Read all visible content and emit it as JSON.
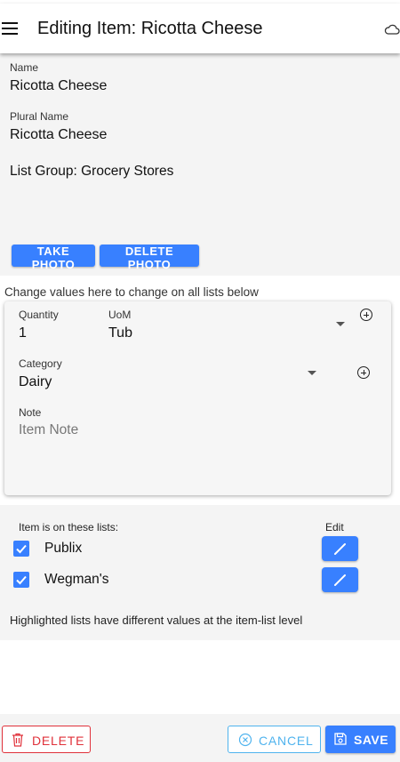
{
  "header": {
    "title": "Editing Item: Ricotta Cheese",
    "menu_icon": "menu-icon",
    "cloud_icon": "cloud-icon"
  },
  "item": {
    "name_label": "Name",
    "name_value": "Ricotta Cheese",
    "plural_label": "Plural Name",
    "plural_value": "Ricotta Cheese",
    "list_group": "List Group: Grocery Stores"
  },
  "photo_buttons": {
    "take": "TAKE PHOTO",
    "delete": "DELETE PHOTO"
  },
  "change_note": "Change values here to change on all lists below",
  "values": {
    "quantity_label": "Quantity",
    "quantity_value": "1",
    "uom_label": "UoM",
    "uom_value": "Tub",
    "category_label": "Category",
    "category_value": "Dairy",
    "note_label": "Note",
    "note_placeholder": "Item Note"
  },
  "lists": {
    "header": "Item is on these lists:",
    "edit_header": "Edit",
    "items": [
      {
        "name": "Publix",
        "checked": true
      },
      {
        "name": "Wegman's",
        "checked": true
      }
    ],
    "footnote": "Highlighted lists have different values at the item-list level"
  },
  "footer": {
    "delete_label": "DELETE",
    "cancel_label": "CANCEL",
    "save_label": "SAVE"
  },
  "colors": {
    "primary": "#3880ff",
    "danger": "#e0313a",
    "secondary": "#4fb3ee"
  }
}
